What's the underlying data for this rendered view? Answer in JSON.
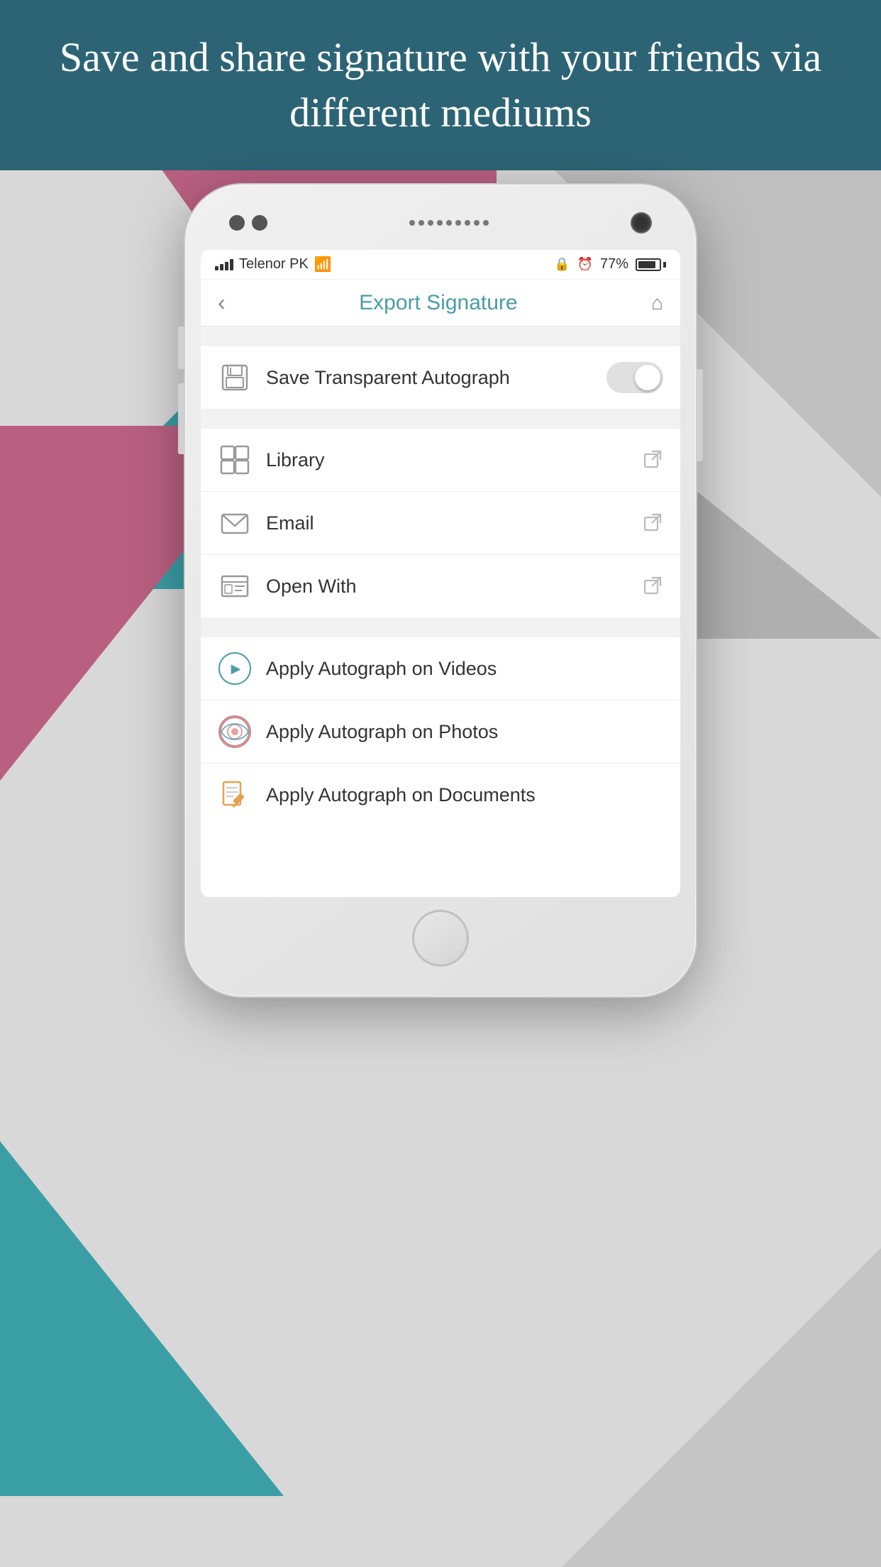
{
  "background": {
    "colors": {
      "teal": "#3a9ea5",
      "pink": "#b96080",
      "gray": "#c0bfbf",
      "banner": "#2d6475"
    }
  },
  "header": {
    "title": "Save and share signature with your friends via different mediums"
  },
  "statusBar": {
    "carrier": "Telenor PK",
    "battery": "77%",
    "time": ""
  },
  "navbar": {
    "title": "Export Signature",
    "backLabel": "‹",
    "homeLabel": "⌂"
  },
  "sections": [
    {
      "id": "transparent",
      "items": [
        {
          "id": "save-transparent",
          "icon": "save-icon",
          "label": "Save Transparent Autograph",
          "hasToggle": true,
          "toggleOn": false,
          "hasExternal": false
        }
      ]
    },
    {
      "id": "share",
      "items": [
        {
          "id": "library",
          "icon": "library-icon",
          "label": "Library",
          "hasToggle": false,
          "hasExternal": true
        },
        {
          "id": "email",
          "icon": "email-icon",
          "label": "Email",
          "hasToggle": false,
          "hasExternal": true
        },
        {
          "id": "open-with",
          "icon": "openwith-icon",
          "label": "Open With",
          "hasToggle": false,
          "hasExternal": true
        }
      ]
    },
    {
      "id": "apply",
      "items": [
        {
          "id": "apply-videos",
          "icon": "video-icon",
          "label": "Apply Autograph on Videos",
          "hasToggle": false,
          "hasExternal": false
        },
        {
          "id": "apply-photos",
          "icon": "photo-icon",
          "label": "Apply Autograph on Photos",
          "hasToggle": false,
          "hasExternal": false
        },
        {
          "id": "apply-documents",
          "icon": "document-icon",
          "label": "Apply Autograph on Documents",
          "hasToggle": false,
          "hasExternal": false
        }
      ]
    }
  ]
}
